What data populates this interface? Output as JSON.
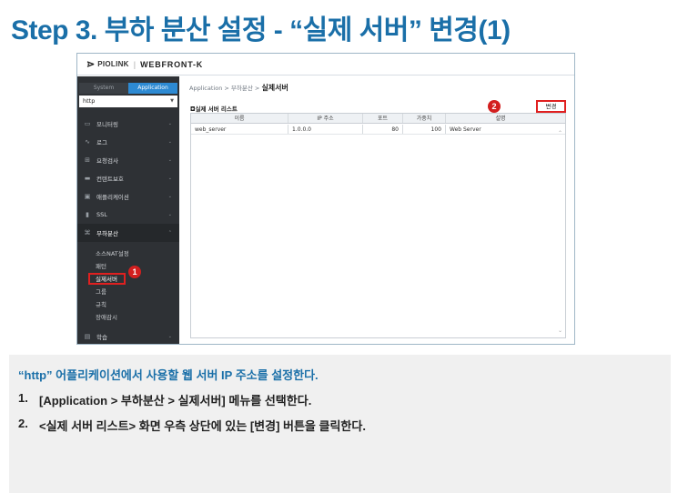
{
  "slide": {
    "title": "Step 3. 부하 분산 설정 - “실제 서버” 변경(1)"
  },
  "app": {
    "brand_mark": "⋗",
    "brand": "PIOLINK",
    "product": "WEBFRONT-K",
    "side_tabs": [
      "System",
      "Application"
    ],
    "selected_app": "http",
    "menu": [
      {
        "label": "모니터링",
        "icon": "monitor-icon",
        "glyph": "▭"
      },
      {
        "label": "로그",
        "icon": "chart-icon",
        "glyph": "∿"
      },
      {
        "label": "요청검사",
        "icon": "inspect-icon",
        "glyph": "⊞"
      },
      {
        "label": "컨텐트보호",
        "icon": "folder-icon",
        "glyph": "▬"
      },
      {
        "label": "애플리케이션",
        "icon": "window-icon",
        "glyph": "▣"
      },
      {
        "label": "SSL",
        "icon": "lock-icon",
        "glyph": "🔒"
      },
      {
        "label": "부하분산",
        "icon": "balance-icon",
        "glyph": "⌘"
      }
    ],
    "submenu": [
      "소스NAT설정",
      "패턴",
      "실제서버",
      "그룹",
      "규칙",
      "장애감시"
    ],
    "menu_after": [
      {
        "label": "학습",
        "icon": "learn-icon",
        "glyph": "▤"
      }
    ],
    "breadcrumb": [
      "Application",
      "부하분산",
      "실제서버"
    ],
    "list_title": "◘실제 서버 리스트",
    "change_button": "변경",
    "table": {
      "columns": [
        "이름",
        "IP 주소",
        "포트",
        "가중치",
        "설명"
      ],
      "rows": [
        [
          "web_server",
          "1.0.0.0",
          "80",
          "100",
          "Web Server"
        ]
      ]
    },
    "markers": [
      "1",
      "2"
    ]
  },
  "description": {
    "heading": "“http” 어플리케이션에서 사용할 웹 서버 IP 주소를 설정한다.",
    "steps": [
      {
        "n": "1.",
        "text": "[Application > 부하분산 > 실제서버] 메뉴를 선택한다."
      },
      {
        "n": "2.",
        "text": "<실제 서버 리스트> 화면 우측 상단에 있는 [변경] 버튼을 클릭한다."
      }
    ]
  }
}
